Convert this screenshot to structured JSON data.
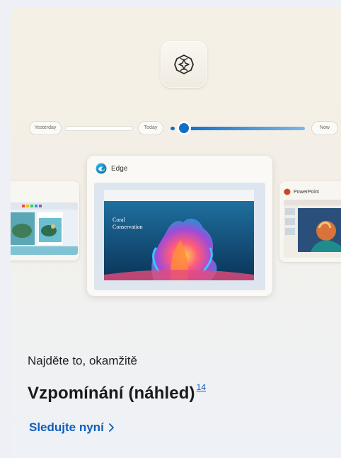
{
  "timeline": {
    "label_yesterday": "Yesterday",
    "label_today": "Today",
    "label_now": "Now"
  },
  "windows": {
    "main_app": "Edge",
    "main_page_heading_line1": "Coral",
    "main_page_heading_line2": "Conservation",
    "right_app": "PowerPoint"
  },
  "content": {
    "subtitle": "Najděte to, okamžitě",
    "headline": "Vzpomínání (náhled)",
    "footnote": "14",
    "link_label": "Sledujte nyní"
  },
  "icons": {
    "app": "recall-icon",
    "edge": "edge-icon",
    "powerpoint": "powerpoint-icon",
    "link": "chevron-right-icon"
  },
  "colors": {
    "accent": "#0f6fc8",
    "link": "#0f5dbd"
  }
}
